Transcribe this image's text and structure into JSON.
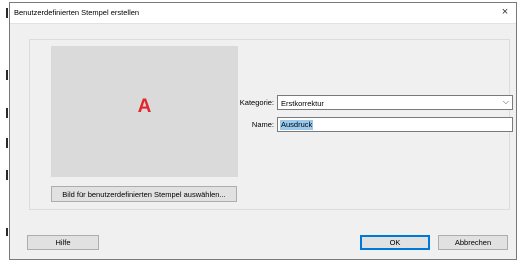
{
  "dialog": {
    "title": "Benutzerdefinierten Stempel erstellen",
    "close_glyph": "×",
    "close_icon": "close-icon"
  },
  "preview": {
    "letter": "A",
    "letter_color": "#e3262b"
  },
  "select_image_button": {
    "label": "Bild für benutzerdefinierten Stempel auswählen..."
  },
  "category": {
    "label": "Kategorie:",
    "value": "Erstkorrektur",
    "chevron_glyph": "⌵",
    "chevron_icon": "chevron-down-icon"
  },
  "name": {
    "label": "Name:",
    "value": "Ausdruck",
    "selection_color": "#99c9ef"
  },
  "footer": {
    "help_label": "Hilfe",
    "ok_label": "OK",
    "cancel_label": "Abbrechen",
    "ok_border_color": "#0078d7"
  }
}
